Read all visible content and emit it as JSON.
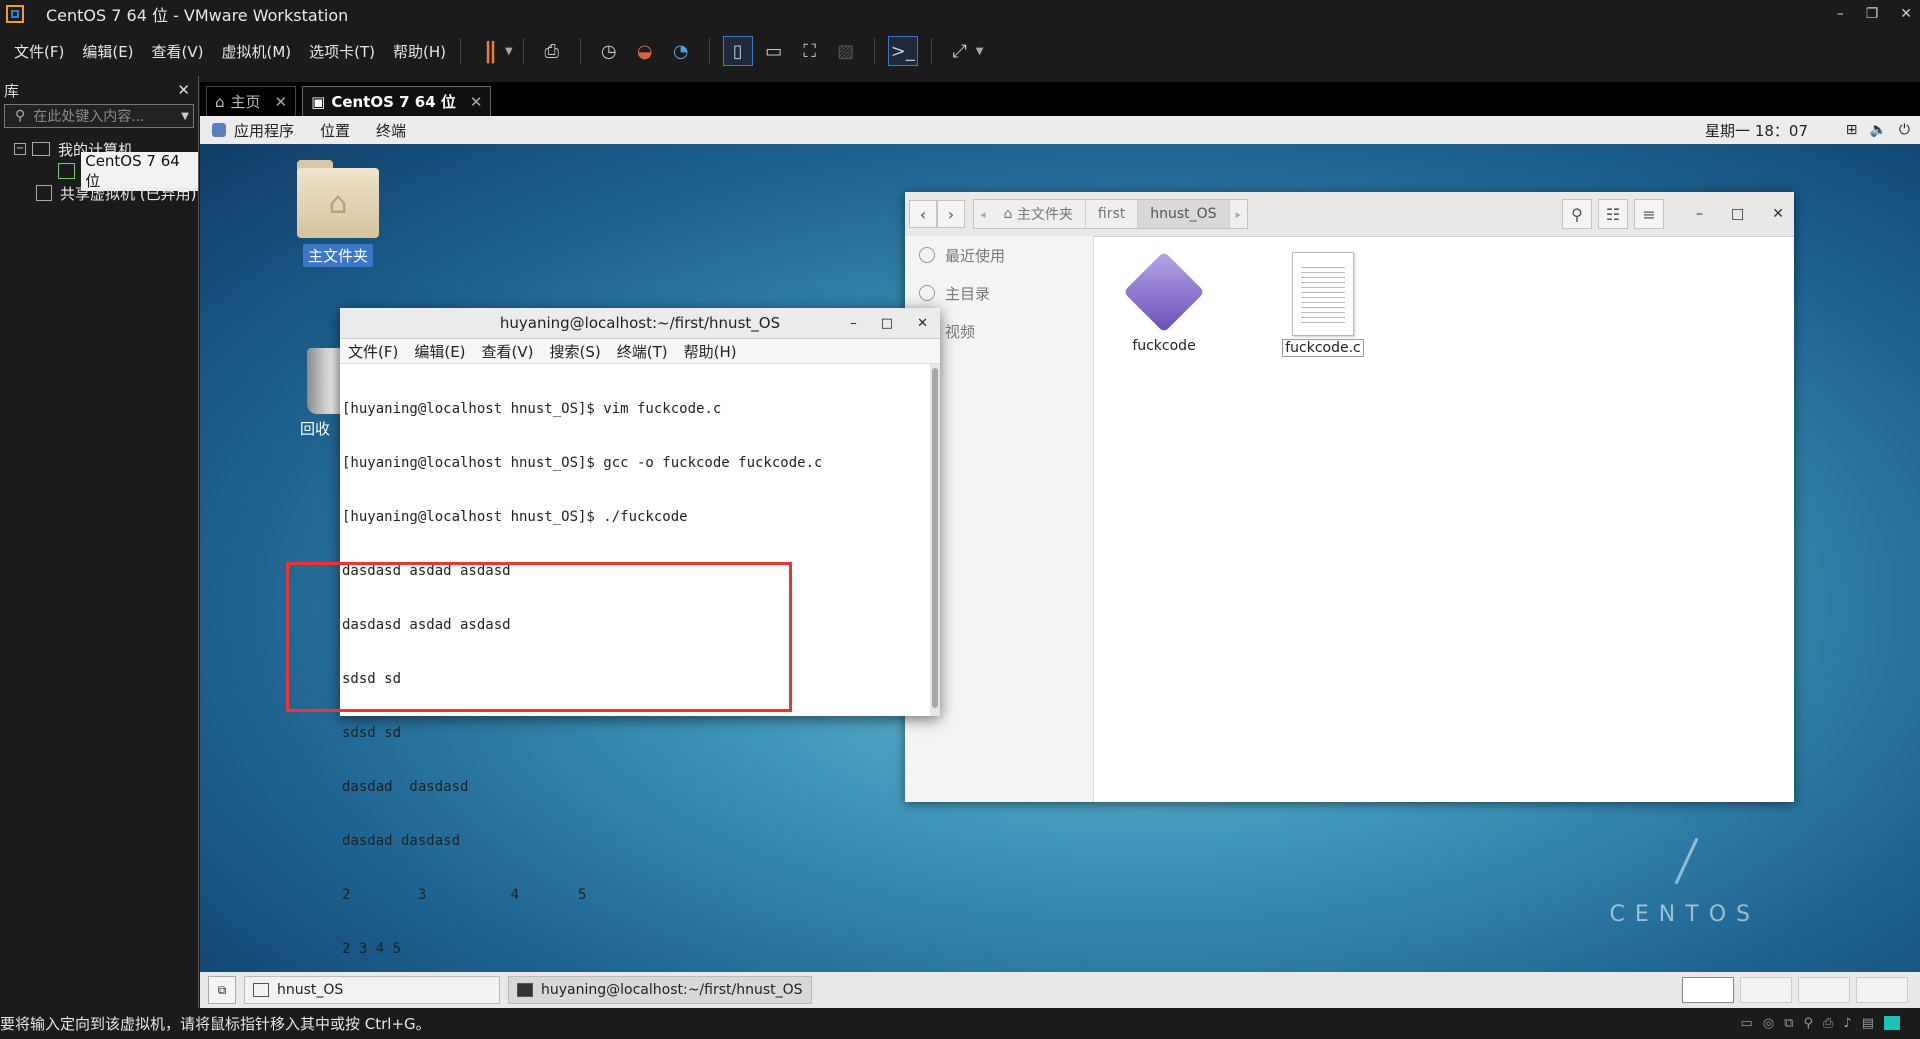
{
  "window": {
    "title": "CentOS 7 64 位 - VMware Workstation",
    "controls": [
      "–",
      "❐",
      "✕"
    ]
  },
  "menu": [
    "文件(F)",
    "编辑(E)",
    "查看(V)",
    "虚拟机(M)",
    "选项卡(T)",
    "帮助(H)"
  ],
  "library": {
    "title": "库",
    "close": "✕",
    "search_placeholder": "在此处键入内容...",
    "my_computer": "我的计算机",
    "vm_name": "CentOS 7 64 位",
    "shared": "共享虚拟机 (已弃用)"
  },
  "tabs": [
    {
      "label": "主页",
      "close": "✕"
    },
    {
      "label": "CentOS 7 64 位",
      "close": "✕"
    }
  ],
  "guest": {
    "topbar": {
      "applications": "应用程序",
      "places": "位置",
      "terminal": "终端",
      "clock": "星期一 18：07"
    },
    "desktop": {
      "home_label": "主文件夹",
      "trash_label": "回收"
    },
    "files_window": {
      "path": [
        "主文件夹",
        "first",
        "hnust_OS"
      ],
      "sidebar": [
        "最近使用",
        "主目录",
        "视频"
      ],
      "items": [
        {
          "name": "fuckcode",
          "kind": "executable"
        },
        {
          "name": "fuckcode.c",
          "kind": "text"
        }
      ]
    },
    "terminal": {
      "title": "huyaning@localhost:~/first/hnust_OS",
      "menu": [
        "文件(F)",
        "编辑(E)",
        "查看(V)",
        "搜索(S)",
        "终端(T)",
        "帮助(H)"
      ],
      "lines": [
        "[huyaning@localhost hnust_OS]$ vim fuckcode.c",
        "[huyaning@localhost hnust_OS]$ gcc -o fuckcode fuckcode.c",
        "[huyaning@localhost hnust_OS]$ ./fuckcode",
        "dasdasd asdad asdasd",
        "dasdasd asdad asdasd",
        "sdsd sd",
        "sdsd sd",
        "dasdad  dasdasd",
        "dasdad dasdasd",
        "2        3          4       5",
        "2 3 4 5"
      ]
    },
    "brand": "CENTOS",
    "taskbar": {
      "tasks": [
        "hnust_OS",
        "huyaning@localhost:~/first/hnust_OS"
      ]
    }
  },
  "statusbar": {
    "message": "要将输入定向到该虚拟机，请将鼠标指针移入其中或按 Ctrl+G。"
  },
  "colors": {
    "highlight": "#e33333",
    "pause_accent": "#f07f28",
    "selection_blue": "#3d75c7"
  }
}
